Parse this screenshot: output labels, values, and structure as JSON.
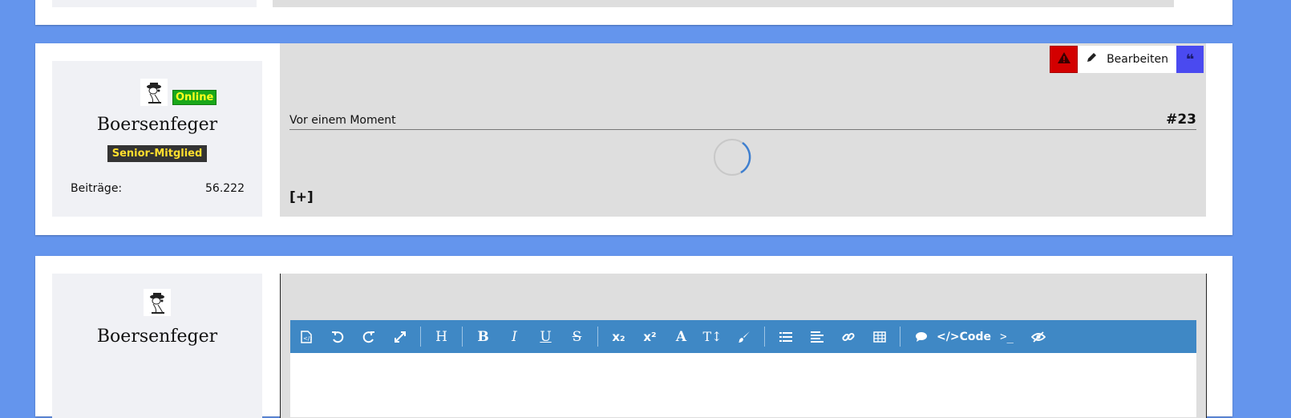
{
  "colors": {
    "page_bg": "#6495ed",
    "toolbar_bg": "#3f88c5",
    "report": "#d30000",
    "quote": "#4a4af0",
    "online": "#1aa81a",
    "rank_bg": "#333333"
  },
  "post": {
    "user": {
      "name": "Boersenfeger",
      "status": "Online",
      "rank": "Senior-Mitglied",
      "posts_label": "Beiträge:",
      "posts_value": "56.222",
      "avatar_icon": "snoopy-avatar-icon"
    },
    "actions": {
      "report_icon": "warning-icon",
      "edit_label": "Bearbeiten",
      "edit_icon": "pencil-icon",
      "quote_icon": "quote-icon"
    },
    "time": "Vor einem Moment",
    "number": "#23",
    "expand_label": "[+]"
  },
  "reply": {
    "user": {
      "name": "Boersenfeger",
      "avatar_icon": "snoopy-avatar-icon"
    },
    "toolbar": {
      "code_label": "Code",
      "icons": [
        "source-icon",
        "undo-icon",
        "redo-icon",
        "fullscreen-icon",
        "heading-icon",
        "bold-icon",
        "italic-icon",
        "underline-icon",
        "strikethrough-icon",
        "subscript-icon",
        "superscript-icon",
        "font-color-icon",
        "font-size-icon",
        "paint-brush-icon",
        "list-icon",
        "align-icon",
        "link-icon",
        "table-icon",
        "comment-icon",
        "code-icon",
        "terminal-icon",
        "preview-icon"
      ]
    }
  }
}
